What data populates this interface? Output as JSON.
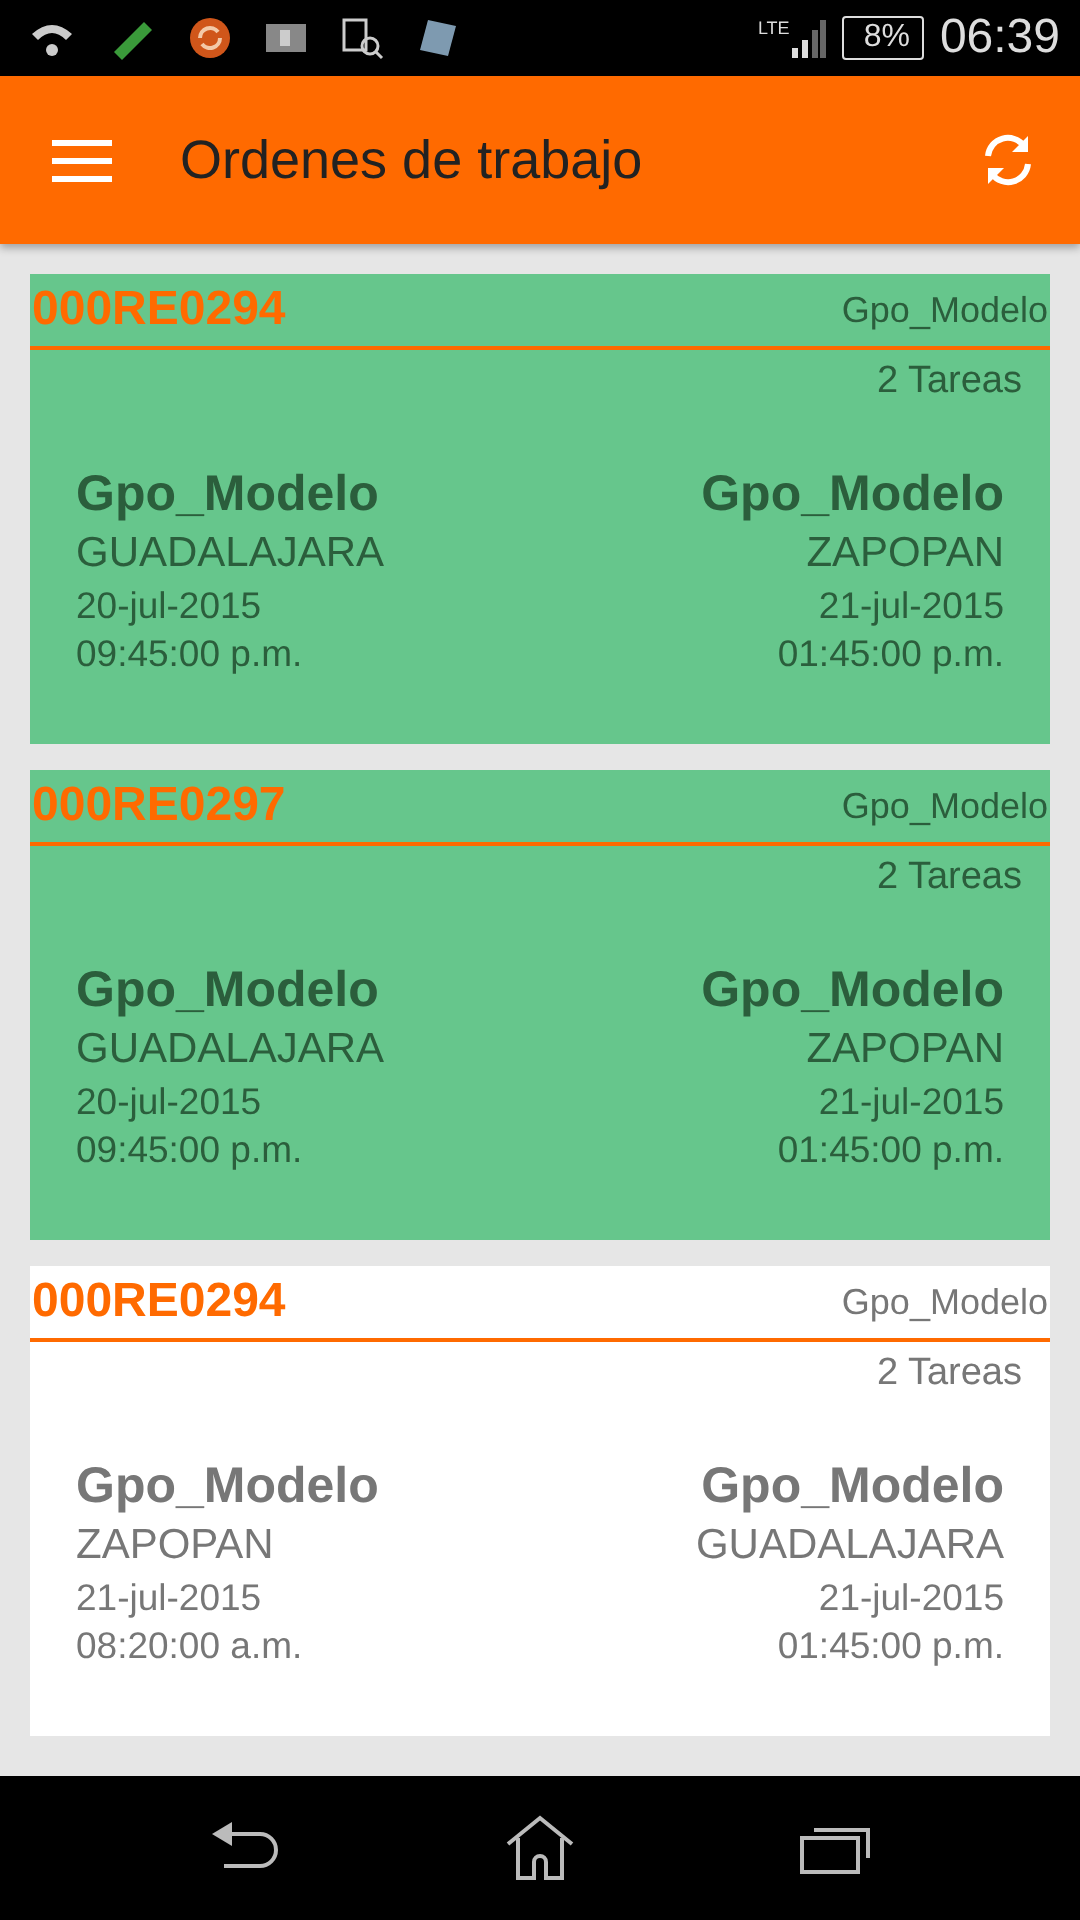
{
  "status_bar": {
    "network": "LTE",
    "battery": "8%",
    "time": "06:39"
  },
  "app_bar": {
    "title": "Ordenes de trabajo"
  },
  "orders": [
    {
      "code": "000RE0294",
      "group": "Gpo_Modelo",
      "tasks": "2 Tareas",
      "highlighted": true,
      "origin": {
        "name": "Gpo_Modelo",
        "city": "GUADALAJARA",
        "date": "20-jul-2015",
        "time": "09:45:00 p.m."
      },
      "destination": {
        "name": "Gpo_Modelo",
        "city": "ZAPOPAN",
        "date": "21-jul-2015",
        "time": "01:45:00 p.m."
      }
    },
    {
      "code": "000RE0297",
      "group": "Gpo_Modelo",
      "tasks": "2 Tareas",
      "highlighted": true,
      "origin": {
        "name": "Gpo_Modelo",
        "city": "GUADALAJARA",
        "date": "20-jul-2015",
        "time": "09:45:00 p.m."
      },
      "destination": {
        "name": "Gpo_Modelo",
        "city": "ZAPOPAN",
        "date": "21-jul-2015",
        "time": "01:45:00 p.m."
      }
    },
    {
      "code": "000RE0294",
      "group": "Gpo_Modelo",
      "tasks": "2 Tareas",
      "highlighted": false,
      "origin": {
        "name": "Gpo_Modelo",
        "city": "ZAPOPAN",
        "date": "21-jul-2015",
        "time": "08:20:00 a.m."
      },
      "destination": {
        "name": "Gpo_Modelo",
        "city": "GUADALAJARA",
        "date": "21-jul-2015",
        "time": "01:45:00 p.m."
      }
    }
  ]
}
